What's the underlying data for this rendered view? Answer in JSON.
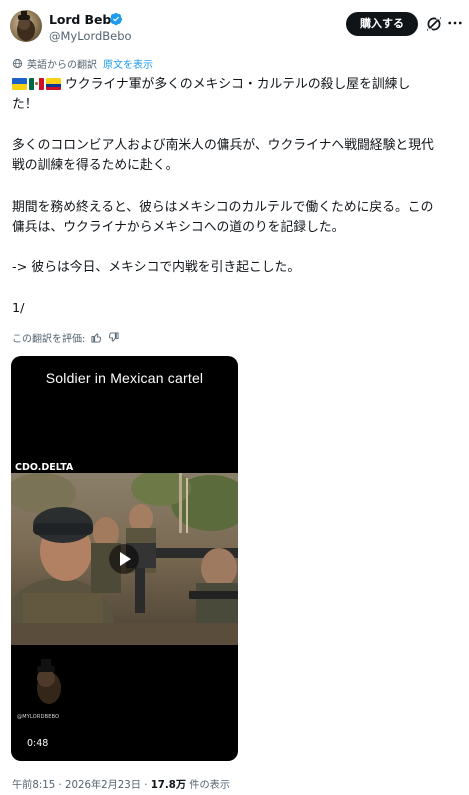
{
  "author": {
    "display_name": "Lord Bebo",
    "handle": "@MyLordBebo",
    "verified": true,
    "avatar": "avatar-image"
  },
  "header": {
    "buy_label": "購入する",
    "grok_icon": "grok-icon",
    "more_icon": "more-icon"
  },
  "translation": {
    "note": "英語からの翻訳",
    "show_original": "原文を表示",
    "icon": "globe-icon"
  },
  "tweet": {
    "flags": [
      "ukraine-flag",
      "mexico-flag",
      "colombia-flag"
    ],
    "line1": "ウクライナ軍が多くのメキシコ・カルテルの殺し屋を訓練し",
    "line2": "た！",
    "line3": "多くのコロンビア人および南米人の傭兵が、ウクライナへ戦闘経験と現代",
    "line4": "戦の訓練を得るために赴く。",
    "line5": "期間を務め終えると、彼らはメキシコのカルテルで働くために戻る。この",
    "line6": "傭兵は、ウクライナからメキシコへの道のりを記録した。",
    "line7": "-> 彼らは今日、メキシコで内戦を引き起こした。",
    "line8": "1/"
  },
  "rating": {
    "label": "この翻訳を評価:",
    "like_icon": "thumbs-up-icon",
    "dislike_icon": "thumbs-down-icon"
  },
  "video": {
    "caption": "Soldier in Mexican cartel",
    "channel_tag": "CDO.DELTA",
    "watermark": "@MYLORDBEBO",
    "duration": "0:48",
    "play_icon": "play-icon"
  },
  "meta": {
    "time": "午前8:15",
    "separator": "·",
    "date": "2026年2月23日",
    "views_count": "17.8万",
    "views_label": "件の表示"
  },
  "colors": {
    "accent": "#1d9bf0",
    "text": "#0f1419",
    "secondary": "#536471",
    "button_bg": "#0f1419"
  }
}
